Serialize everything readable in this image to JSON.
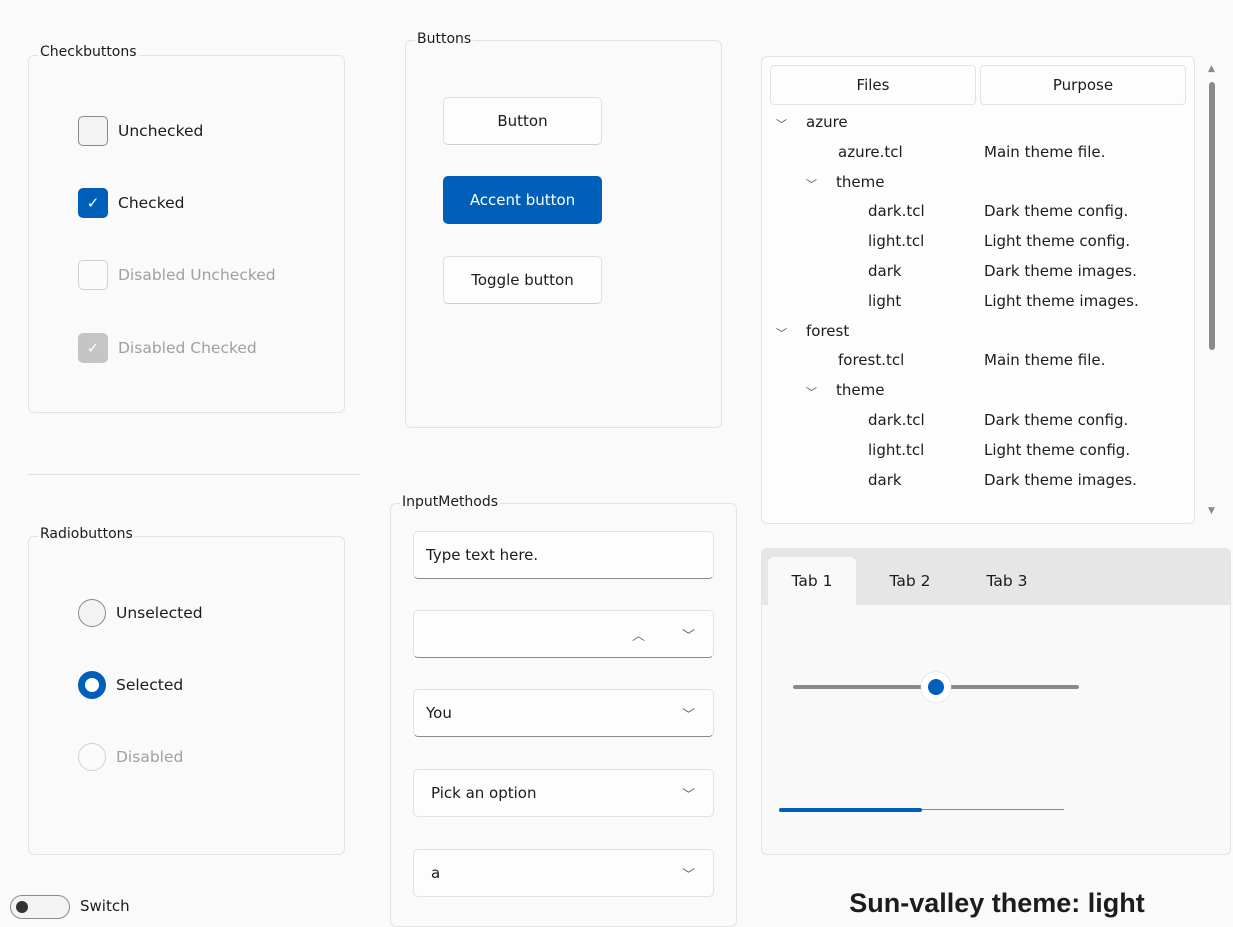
{
  "checkbuttons": {
    "title": "Checkbuttons",
    "items": [
      {
        "label": "Unchecked",
        "state": "unchecked"
      },
      {
        "label": "Checked",
        "state": "checked"
      },
      {
        "label": "Disabled Unchecked",
        "state": "disabled-unchecked"
      },
      {
        "label": "Disabled Checked",
        "state": "disabled-checked"
      }
    ]
  },
  "radiobuttons": {
    "title": "Radiobuttons",
    "items": [
      {
        "label": "Unselected"
      },
      {
        "label": "Selected"
      },
      {
        "label": "Disabled"
      }
    ]
  },
  "switch": {
    "label": "Switch",
    "on": false
  },
  "buttons": {
    "title": "Buttons",
    "button": "Button",
    "accent": "Accent button",
    "toggle": "Toggle button"
  },
  "inputs": {
    "title": "InputMethods",
    "entry": "Type text here.",
    "spinbox": "",
    "combo1": "You",
    "combo2": "Pick an option",
    "combo3": "a"
  },
  "tree": {
    "headers": [
      "Files",
      "Purpose"
    ],
    "rows": [
      {
        "level": 0,
        "name": "azure",
        "purpose": "",
        "expanded": true
      },
      {
        "level": 1,
        "name": "azure.tcl",
        "purpose": "Main theme file."
      },
      {
        "level": 1,
        "name": "theme",
        "purpose": "",
        "expanded": true
      },
      {
        "level": 2,
        "name": "dark.tcl",
        "purpose": "Dark theme config."
      },
      {
        "level": 2,
        "name": "light.tcl",
        "purpose": "Light theme config."
      },
      {
        "level": 2,
        "name": "dark",
        "purpose": "Dark theme images."
      },
      {
        "level": 2,
        "name": "light",
        "purpose": "Light theme images."
      },
      {
        "level": 0,
        "name": "forest",
        "purpose": "",
        "expanded": true
      },
      {
        "level": 1,
        "name": "forest.tcl",
        "purpose": "Main theme file."
      },
      {
        "level": 1,
        "name": "theme",
        "purpose": "",
        "expanded": true
      },
      {
        "level": 2,
        "name": "dark.tcl",
        "purpose": "Dark theme config."
      },
      {
        "level": 2,
        "name": "light.tcl",
        "purpose": "Light theme config."
      },
      {
        "level": 2,
        "name": "dark",
        "purpose": "Dark theme images."
      }
    ]
  },
  "notebook": {
    "tabs": [
      "Tab 1",
      "Tab 2",
      "Tab 3"
    ],
    "selected": 0,
    "slider_percent": 50,
    "progress_percent": 50
  },
  "theme_label": "Sun-valley theme: light",
  "colors": {
    "accent": "#005fb8",
    "background": "#fafafa"
  }
}
